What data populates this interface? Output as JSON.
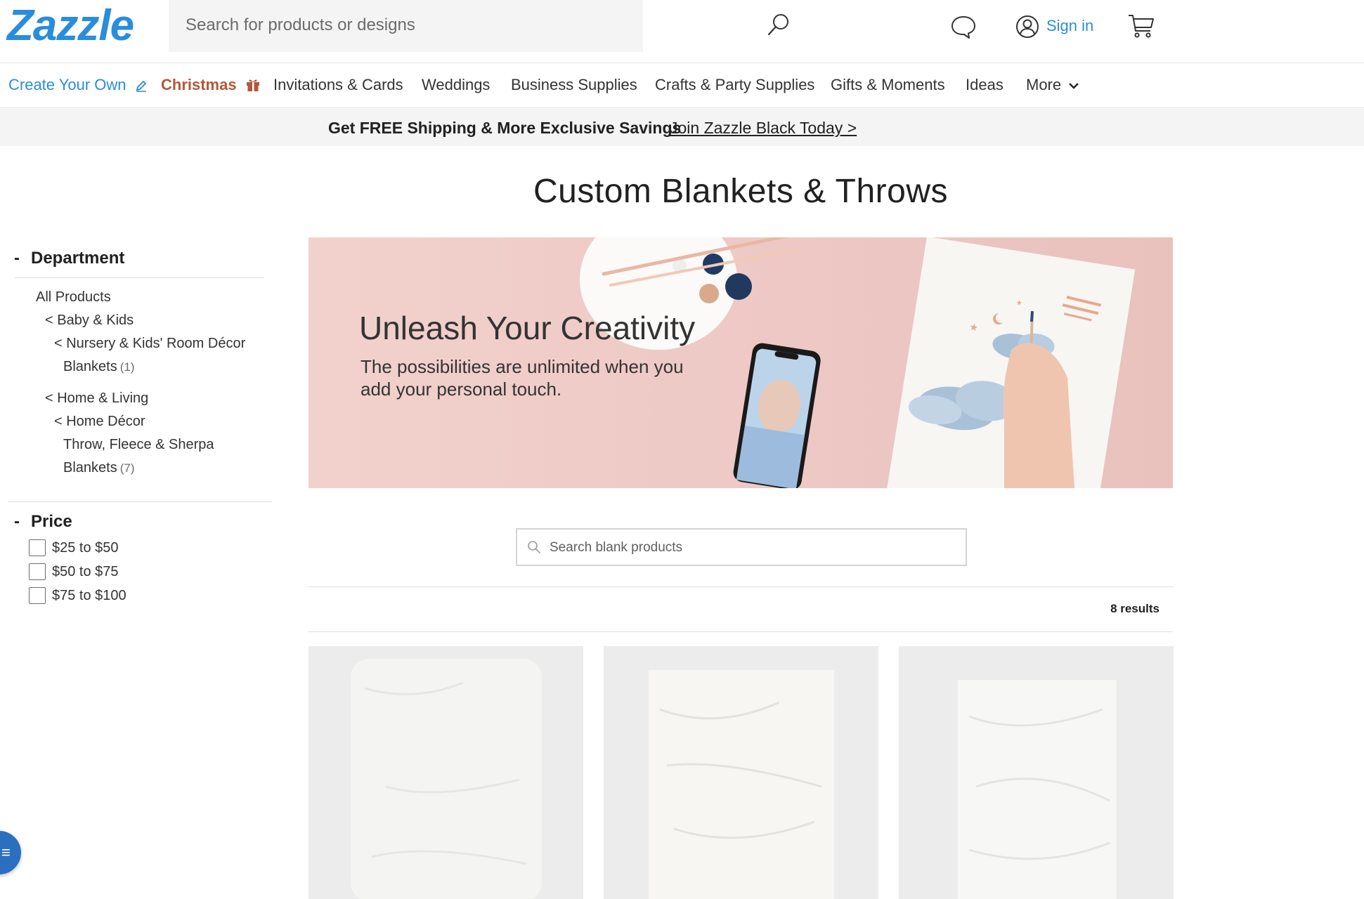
{
  "header": {
    "logo": "Zazzle",
    "search_placeholder": "Search for products or designs",
    "chat_icon": "chat-bubble-icon",
    "user_icon": "user-circle-icon",
    "sign_in": "Sign in",
    "cart_icon": "shopping-cart-icon"
  },
  "nav": {
    "items": [
      {
        "label": "Create Your Own",
        "icon": "pencil-icon"
      },
      {
        "label": "Christmas",
        "icon": "gift-icon"
      },
      {
        "label": "Invitations & Cards"
      },
      {
        "label": "Weddings"
      },
      {
        "label": "Business Supplies"
      },
      {
        "label": "Crafts & Party Supplies"
      },
      {
        "label": "Gifts & Moments"
      },
      {
        "label": "Ideas"
      },
      {
        "label": "More",
        "icon": "chevron-down-icon"
      }
    ]
  },
  "promo": {
    "text": "Get FREE Shipping & More Exclusive Savings",
    "link": "Join Zazzle Black Today >"
  },
  "page": {
    "title": "Custom Blankets & Throws"
  },
  "sidebar": {
    "department": {
      "toggle": "-",
      "title": "Department",
      "links": [
        {
          "label": "All Products",
          "count": ""
        },
        {
          "label": "< Baby & Kids",
          "count": ""
        },
        {
          "label": "< Nursery & Kids' Room Décor",
          "count": ""
        },
        {
          "label": "Blankets",
          "count": "(1)"
        },
        {
          "label": "< Home & Living",
          "count": ""
        },
        {
          "label": "< Home Décor",
          "count": ""
        },
        {
          "label": "Throw, Fleece & Sherpa",
          "count": ""
        },
        {
          "label": "Blankets",
          "count": "(7)"
        }
      ]
    },
    "price": {
      "toggle": "-",
      "title": "Price",
      "options": [
        {
          "label": "$25 to $50",
          "checked": false
        },
        {
          "label": "$50 to $75",
          "checked": false
        },
        {
          "label": "$75 to $100",
          "checked": false
        }
      ]
    }
  },
  "hero": {
    "title": "Unleash Your Creativity",
    "subtitle": "The possibilities are unlimited when you add your personal touch."
  },
  "blank_search": {
    "placeholder": "Search blank products"
  },
  "results": {
    "count_text": "8 results"
  },
  "colors": {
    "brand_blue": "#2a8ddb",
    "christmas_red": "#b3573a",
    "hero_pink": "#f0cfcb",
    "promo_bg": "#f4f4f4",
    "tile_bg": "#ececec"
  }
}
